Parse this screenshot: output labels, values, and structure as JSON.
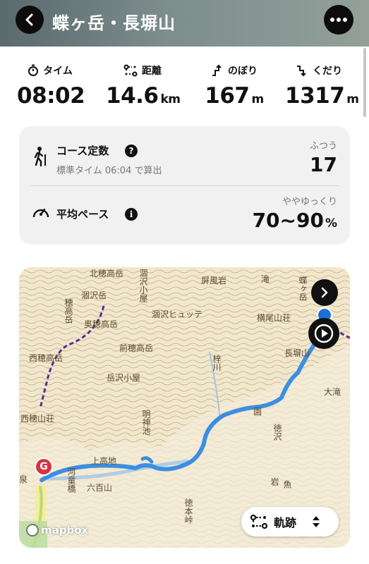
{
  "header": {
    "title": "蝶ヶ岳・長塀山"
  },
  "stats": [
    {
      "icon": "stopwatch-icon",
      "label": "タイム",
      "value": "08:02",
      "unit": ""
    },
    {
      "icon": "route-distance-icon",
      "label": "距離",
      "value": "14.6",
      "unit": "km"
    },
    {
      "icon": "ascent-icon",
      "label": "のぼり",
      "value": "167",
      "unit": "m"
    },
    {
      "icon": "descent-icon",
      "label": "くだり",
      "value": "1317",
      "unit": "m"
    }
  ],
  "course": {
    "label": "コース定数",
    "help": "?",
    "sub": "標準タイム 06:04 で算出",
    "rating": "ふつう",
    "value": "17"
  },
  "pace": {
    "label": "平均ペース",
    "info": "i",
    "rating": "ややゆっくり",
    "value": "70~90",
    "unit": "%"
  },
  "map": {
    "labels": {
      "kitaho": "北穂高岳",
      "karasawa": "涸沢岳",
      "karasawa_hut": "涸沢小屋",
      "hodaka": "穂高岳",
      "okuho": "奥穂高岳",
      "karasawa_hutte": "涸沢ヒュッテ",
      "byobu": "屏風岩",
      "taki": "滝",
      "yokoo": "横尾山荘",
      "cho": "蝶ヶ岳",
      "nagakabe": "長塀山",
      "nishiho": "西穂高岳",
      "maeho": "前穂高岳",
      "azusa": "梓川",
      "takesawa": "岳沢小屋",
      "nishiho_sanso": "西穂山荘",
      "en": "園",
      "myojin": "明神池",
      "kamikochi": "上高地",
      "ootaki": "大滝",
      "tokusawa": "徳沢",
      "rokuhyaku": "六百山",
      "kappa": "河童橋",
      "gyo": "魚",
      "tokugo": "徳本峠",
      "sen": "泉",
      "iwa": "岩"
    },
    "goal_marker": "G",
    "attribution": "mapbox",
    "mode_label": "軌跡"
  },
  "colors": {
    "route": "#3b8fe0",
    "ridge_trail": "#5a2d8f",
    "goal": "#d5333f",
    "card_bg": "#f1f1f1"
  }
}
